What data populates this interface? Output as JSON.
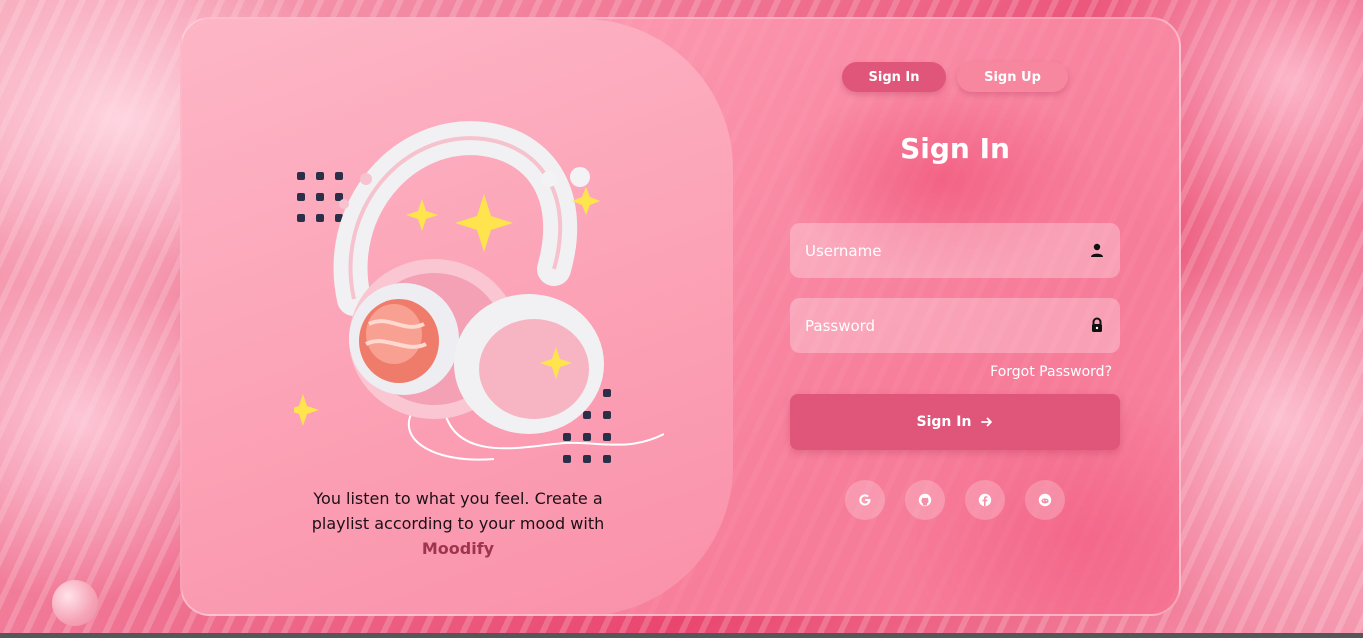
{
  "tabs": {
    "signin_label": "Sign In",
    "signup_label": "Sign Up"
  },
  "form": {
    "title": "Sign In",
    "username_placeholder": "Username",
    "password_placeholder": "Password",
    "forgot_label": "Forgot Password?",
    "submit_label": "Sign In",
    "submit_icon": "arrow-right-icon",
    "username_icon": "user-icon",
    "password_icon": "lock-icon"
  },
  "social": [
    {
      "name": "google-icon"
    },
    {
      "name": "github-icon"
    },
    {
      "name": "facebook-icon"
    },
    {
      "name": "reddit-icon"
    }
  ],
  "hero": {
    "tagline": "You listen to what you feel. Create a playlist according to your mood with",
    "brand": "Moodify"
  },
  "colors": {
    "accent": "#e0567a",
    "secondary": "#f6879f",
    "panel": "#fca3b7",
    "brand_text": "#9e3550"
  }
}
